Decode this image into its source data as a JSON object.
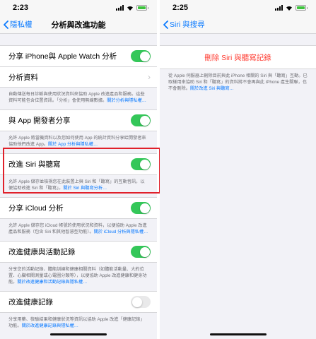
{
  "left": {
    "status": {
      "time": "2:23"
    },
    "nav": {
      "back_label": "隱私權",
      "title": "分析與改進功能"
    },
    "share_iphone_watch": {
      "label": "分享 iPhone與 Apple Watch 分析",
      "enabled": true
    },
    "analytics_data": {
      "label": "分析資料"
    },
    "footer1": {
      "text": "自動傳送每日診斷與使用狀況資料來協助 Apple 改進產品和服務。這些資料可能包含位置資訊。「分析」會使用無線數據。",
      "link": "關於分析與隱私權…"
    },
    "share_app_dev": {
      "label": "與 App 開發者分享",
      "enabled": true
    },
    "footer2": {
      "text": "允許 Apple 將當機資料以及您如何使用 App 的統計資料分享給開發者來協助他們改進 App。",
      "link": "關於 App 分析與隱私權…"
    },
    "improve_siri": {
      "label": "改進 Siri 與聽寫",
      "enabled": true
    },
    "footer3": {
      "text": "允許 Apple 儲存並檢視您在此裝置上與 Siri 和「聽寫」的互動音訊，以便協助改進 Siri 和「聽寫」。",
      "link": "關於 Siri 與聽寫分析…"
    },
    "share_icloud": {
      "label": "分享 iCloud 分析",
      "enabled": true
    },
    "footer4": {
      "text": "允許 Apple 儲存您 iCloud 帳號的使用狀況和資料，以便協助 Apple 改進產品和服務（包含 Siri 和其他智慧型功能）。",
      "link": "關於 iCloud 分析與隱私權…"
    },
    "improve_health": {
      "label": "改進健康與活動記錄",
      "enabled": true
    },
    "footer5": {
      "text": "分享您的活動記錄、體能訓練和健康相關資料（如體能活動量、大約位置、心臟相關測量或心電圖分類等），以便協助 Apple 改進健康和健身功能。",
      "link": "關於改進健康和活動記錄與隱私權…"
    },
    "improve_health_records": {
      "label": "改進健康記錄",
      "enabled": false
    },
    "footer6": {
      "text": "分享用藥、檢驗結果和健康狀況等資訊以協助 Apple 改進「健康記錄」功能。",
      "link": "關於改進健康記錄與隱私權…"
    }
  },
  "right": {
    "status": {
      "time": "2:25"
    },
    "nav": {
      "back_label": "Siri 與搜尋"
    },
    "delete_button": {
      "label": "刪除 Siri 與聽寫記錄"
    },
    "footer": {
      "text": "從 Apple 伺服器上刪除目前與此 iPhone 相關的 Siri 與「聽寫」互動。已取樣用來協助 Siri 和「聽寫」的資料將不會再與此 iPhone 產生關聯，也不會刪除。",
      "link": "關於改進 Siri 與聽寫…"
    }
  },
  "colors": {
    "accent": "#0a7aff",
    "toggle_on": "#34c759",
    "destructive": "#ff3b30",
    "highlight": "#e0202a"
  }
}
